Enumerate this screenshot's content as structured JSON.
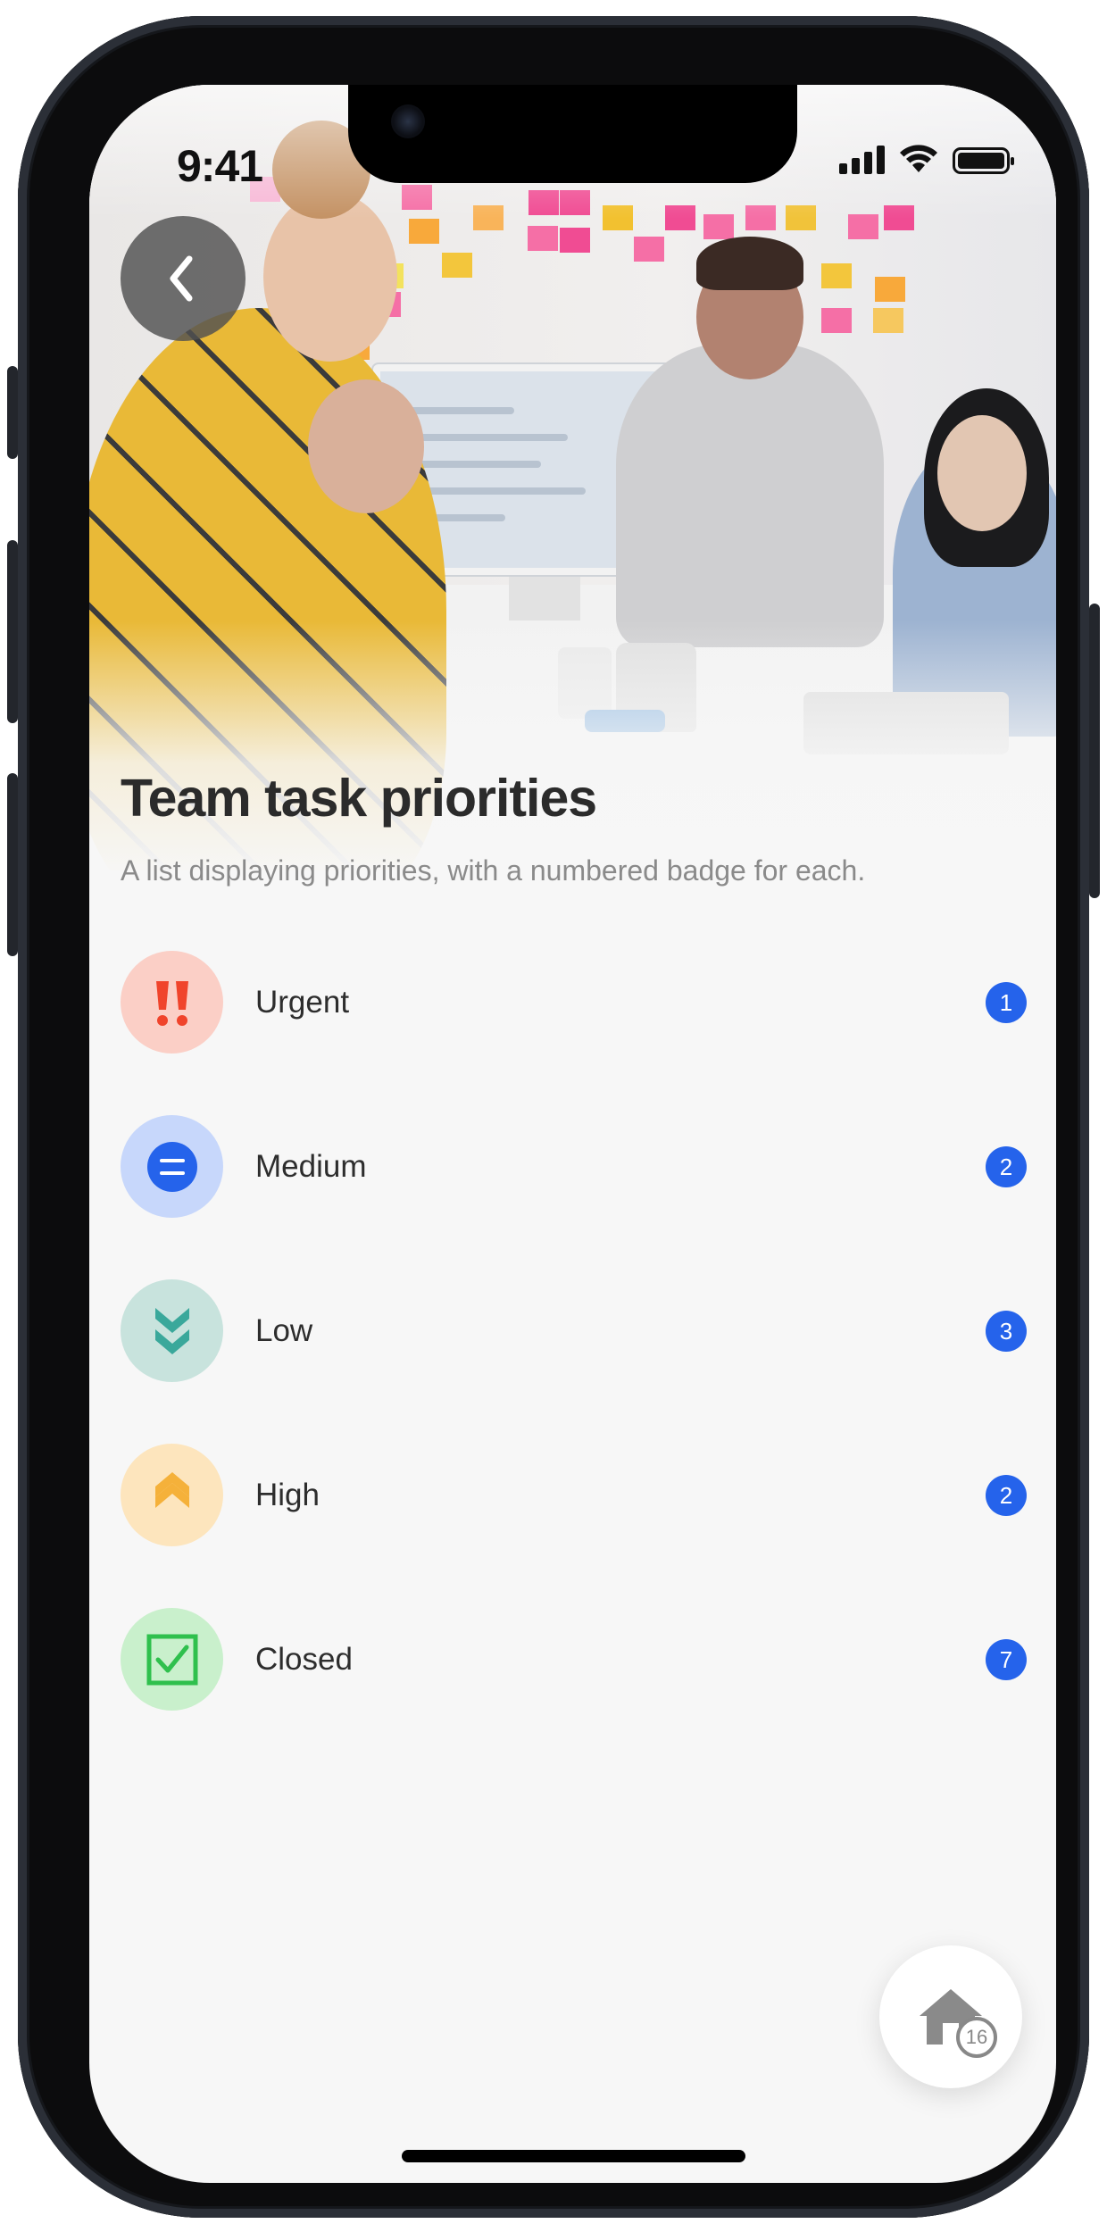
{
  "status_bar": {
    "time": "9:41"
  },
  "header": {
    "title": "Team task priorities",
    "subtitle": "A list displaying priorities, with a numbered badge for each."
  },
  "priorities": [
    {
      "label": "Urgent",
      "count": "1",
      "icon": "double-exclamation-icon",
      "bg": "#fbcfc6",
      "fg": "#f0442b"
    },
    {
      "label": "Medium",
      "count": "2",
      "icon": "equals-circle-icon",
      "bg": "#c7d7fb",
      "fg": "#2563eb"
    },
    {
      "label": "Low",
      "count": "3",
      "icon": "double-chevron-down-icon",
      "bg": "#c8e3dd",
      "fg": "#3aa89b"
    },
    {
      "label": "High",
      "count": "2",
      "icon": "double-chevron-up-icon",
      "bg": "#fde5bd",
      "fg": "#f5b13a"
    },
    {
      "label": "Closed",
      "count": "7",
      "icon": "checkbox-checked-icon",
      "bg": "#c9f0cc",
      "fg": "#2fc04d"
    }
  ],
  "fab": {
    "icon": "home-icon",
    "count": "16"
  },
  "colors": {
    "badge": "#2563eb",
    "background": "#f7f7f7",
    "title": "#2b2b2b"
  }
}
